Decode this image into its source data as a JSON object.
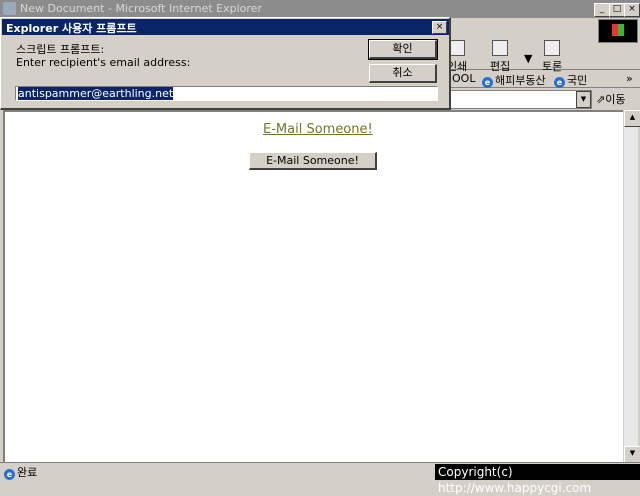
{
  "window": {
    "title": "New Document - Microsoft Internet Explorer",
    "caption_buttons": [
      "_",
      "□",
      "×"
    ]
  },
  "toolbar": {
    "buttons": [
      {
        "label": "인쇄",
        "icon": "print-icon"
      },
      {
        "label": "편집",
        "icon": "edit-icon"
      },
      {
        "label": "토론",
        "icon": "discuss-icon"
      }
    ]
  },
  "links": {
    "partial": "OOL",
    "items": [
      "해피부동산",
      "국민"
    ],
    "more": "»"
  },
  "address": {
    "go_label": "이동"
  },
  "content": {
    "link_text": "E-Mail Someone!",
    "button_label": "E-Mail Someone!"
  },
  "status": {
    "text": "완료",
    "copyright": "Copyright(c) http://www.happycgi.com"
  },
  "dialog": {
    "title": "Explorer 사용자 프롬프트",
    "script_label": "스크립트 프롬프트:",
    "prompt_text": "Enter recipient's email address:",
    "ok_label": "확인",
    "cancel_label": "취소",
    "input_value": "antispammer@earthling.net",
    "close_glyph": "×"
  }
}
